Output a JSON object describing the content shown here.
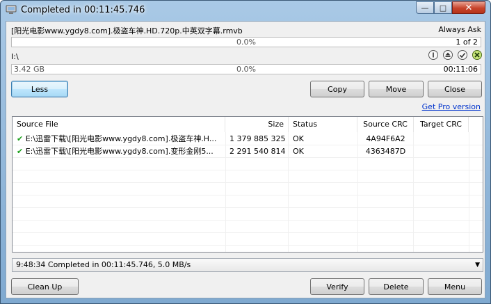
{
  "window": {
    "title": "Completed in 00:11:45.746",
    "minimize_glyph": "—",
    "maximize_glyph": "□",
    "close_glyph": "✕"
  },
  "source": {
    "file": "[阳光电影www.ygdy8.com].极盗车神.HD.720p.中英双字幕.rmvb",
    "mode": "Always Ask",
    "progress_pct": "0.0%",
    "progress_fraction": 0,
    "counter": "1 of 2"
  },
  "target": {
    "path": "I:\\",
    "free_space": "3.42 GB",
    "progress_pct": "0.0%",
    "progress_fraction": 0,
    "elapsed": "00:11:06"
  },
  "buttons": {
    "less": "Less",
    "copy": "Copy",
    "move": "Move",
    "close": "Close",
    "clean_up": "Clean Up",
    "verify": "Verify",
    "delete": "Delete",
    "menu": "Menu"
  },
  "link": {
    "get_pro": "Get Pro version"
  },
  "table": {
    "headers": {
      "source_file": "Source File",
      "size": "Size",
      "status": "Status",
      "source_crc": "Source CRC",
      "target_crc": "Target CRC"
    },
    "rows": [
      {
        "check": "✔",
        "file": "E:\\迅雷下载\\[阳光电影www.ygdy8.com].极盗车神.H...",
        "size": "1 379 885 325",
        "status": "OK",
        "source_crc": "4A94F6A2",
        "target_crc": ""
      },
      {
        "check": "✔",
        "file": "E:\\迅雷下载\\[阳光电影www.ygdy8.com].变形金刚5...",
        "size": "2 291 540 814",
        "status": "OK",
        "source_crc": "4363487D",
        "target_crc": ""
      }
    ]
  },
  "log": {
    "selected": "9:48:34 Completed in 00:11:45.746, 5.0 MB/s",
    "arrow_glyph": "▼"
  },
  "colors": {
    "accent": "#0033cc",
    "progress": "#06b025",
    "ok_check": "#1aa01a",
    "verify_icon_bg": "#c8e67a"
  }
}
